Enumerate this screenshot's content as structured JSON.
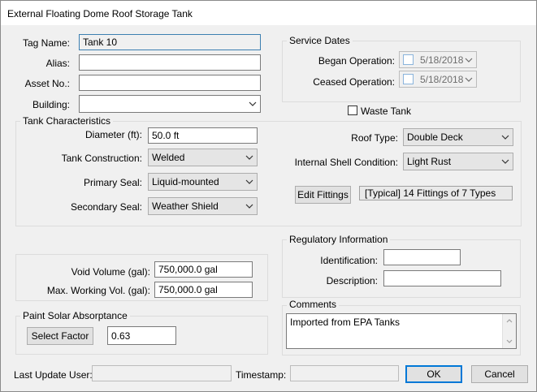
{
  "window": {
    "title": "External Floating Dome Roof Storage Tank"
  },
  "general": {
    "tag_name_label": "Tag Name:",
    "tag_name_value": "Tank 10",
    "alias_label": "Alias:",
    "alias_value": "",
    "asset_no_label": "Asset No.:",
    "asset_no_value": "",
    "building_label": "Building:",
    "building_value": ""
  },
  "service_dates": {
    "title": "Service Dates",
    "began_label": "Began Operation:",
    "began_value": "5/18/2018",
    "ceased_label": "Ceased Operation:",
    "ceased_value": "5/18/2018"
  },
  "waste_tank": {
    "label": "Waste Tank",
    "checked": false
  },
  "tank_characteristics": {
    "title": "Tank Characteristics",
    "diameter_label": "Diameter (ft):",
    "diameter_value": "50.0 ft",
    "construction_label": "Tank Construction:",
    "construction_value": "Welded",
    "primary_seal_label": "Primary Seal:",
    "primary_seal_value": "Liquid-mounted",
    "secondary_seal_label": "Secondary Seal:",
    "secondary_seal_value": "Weather Shield",
    "roof_type_label": "Roof Type:",
    "roof_type_value": "Double Deck",
    "shell_condition_label": "Internal Shell Condition:",
    "shell_condition_value": "Light Rust",
    "edit_fittings_label": "Edit Fittings",
    "fittings_summary": "[Typical] 14 Fittings of 7 Types"
  },
  "volumes": {
    "void_label": "Void Volume (gal):",
    "void_value": "750,000.0 gal",
    "max_label": "Max. Working Vol. (gal):",
    "max_value": "750,000.0 gal"
  },
  "regulatory": {
    "title": "Regulatory Information",
    "identification_label": "Identification:",
    "identification_value": "",
    "description_label": "Description:",
    "description_value": ""
  },
  "paint": {
    "title": "Paint Solar Absorptance",
    "select_factor_label": "Select Factor",
    "value": "0.63"
  },
  "comments": {
    "title": "Comments",
    "text": "Imported from EPA Tanks"
  },
  "footer": {
    "last_update_label": "Last Update User:",
    "last_update_value": "",
    "timestamp_label": "Timestamp:",
    "timestamp_value": "",
    "ok_label": "OK",
    "cancel_label": "Cancel"
  },
  "icons": {
    "chevron": "chevron-down-icon",
    "scroll_up": "scroll-up-arrow-icon",
    "scroll_down": "scroll-down-arrow-icon"
  },
  "colors": {
    "window_bg": "#f0f0f0",
    "focus_border": "#3c7fb1",
    "default_button_border": "#0078d7"
  }
}
